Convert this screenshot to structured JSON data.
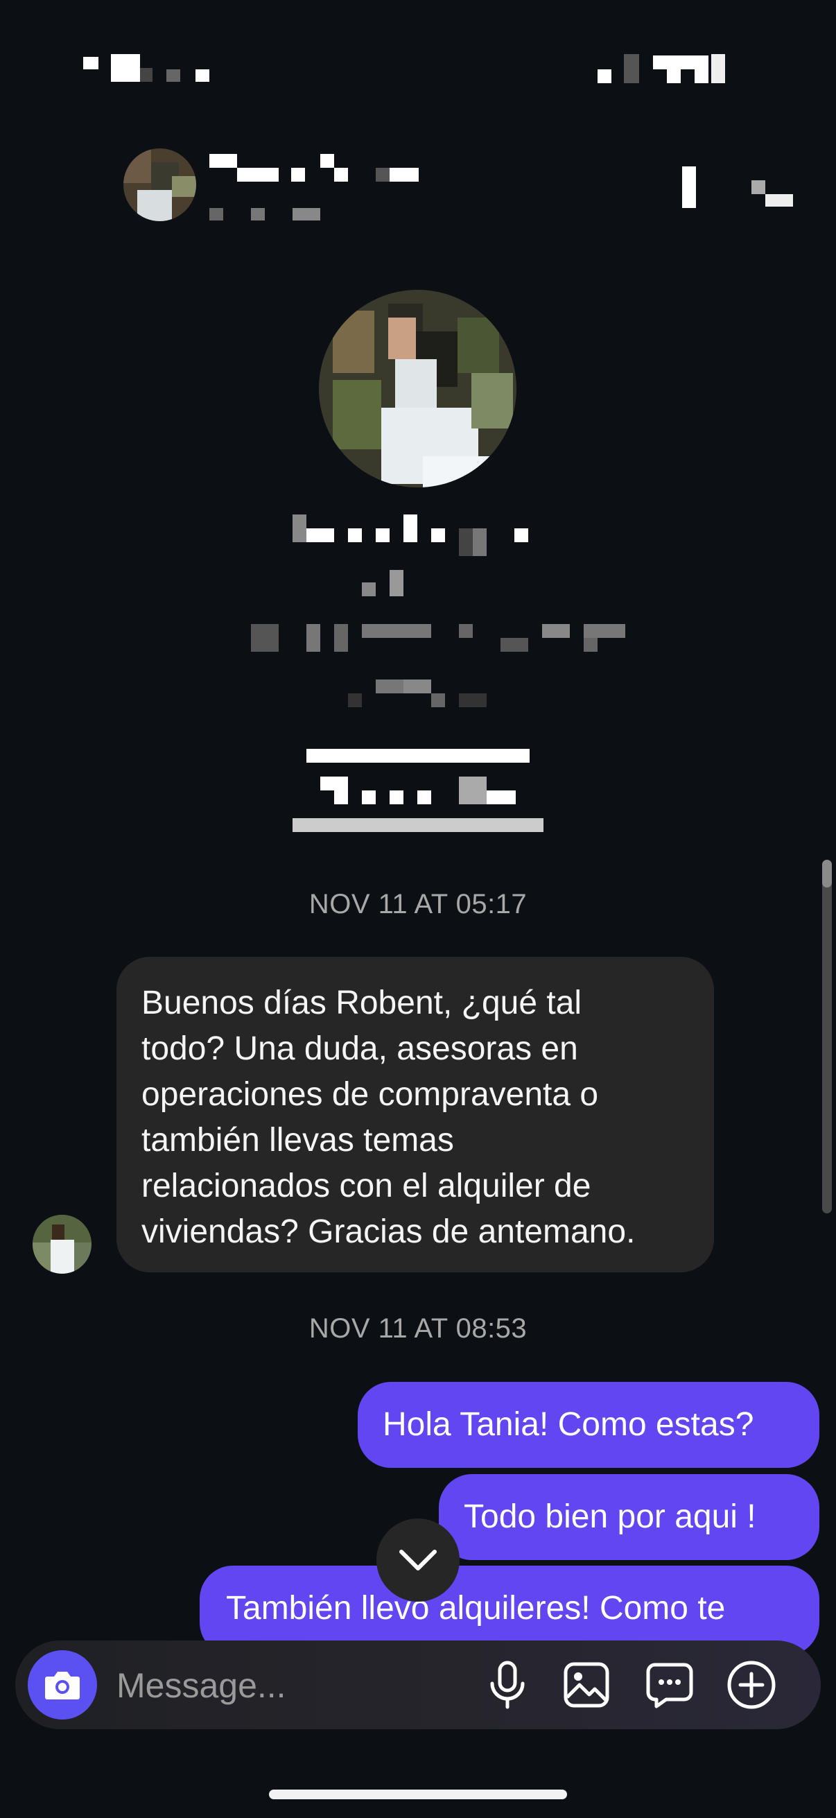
{
  "status_bar": {
    "time": "",
    "signal": "",
    "battery": ""
  },
  "header": {
    "contact_name": "",
    "contact_subtitle": ""
  },
  "profile": {
    "name": "",
    "username": "",
    "details": "",
    "mutual": "",
    "view_profile_label": ""
  },
  "conversation": {
    "timestamps": [
      "NOV 11 AT 05:17",
      "NOV 11 AT 08:53"
    ],
    "incoming": [
      {
        "text": "Buenos días Robent, ¿qué tal\ntodo? Una duda, asesoras en\noperaciones de compraventa o\ntambién llevas temas\nrelacionados con el alquiler de\nviviendas? Gracias de antemano."
      }
    ],
    "outgoing": [
      {
        "text": "Hola Tania! Como estas?"
      },
      {
        "text": "Todo bien por aqui !"
      },
      {
        "text": "También llevo alquileres! Como te"
      }
    ]
  },
  "composer": {
    "placeholder": "Message...",
    "buttons": [
      "camera-icon",
      "microphone-icon",
      "image-icon",
      "sticker-chat-icon",
      "plus-circle-icon"
    ]
  },
  "colors": {
    "background": "#0c1014",
    "incoming_bubble": "#262626",
    "outgoing_bubble": "#6146f1",
    "camera_button": "#5b51f2",
    "timestamp": "#a8a8a8"
  }
}
